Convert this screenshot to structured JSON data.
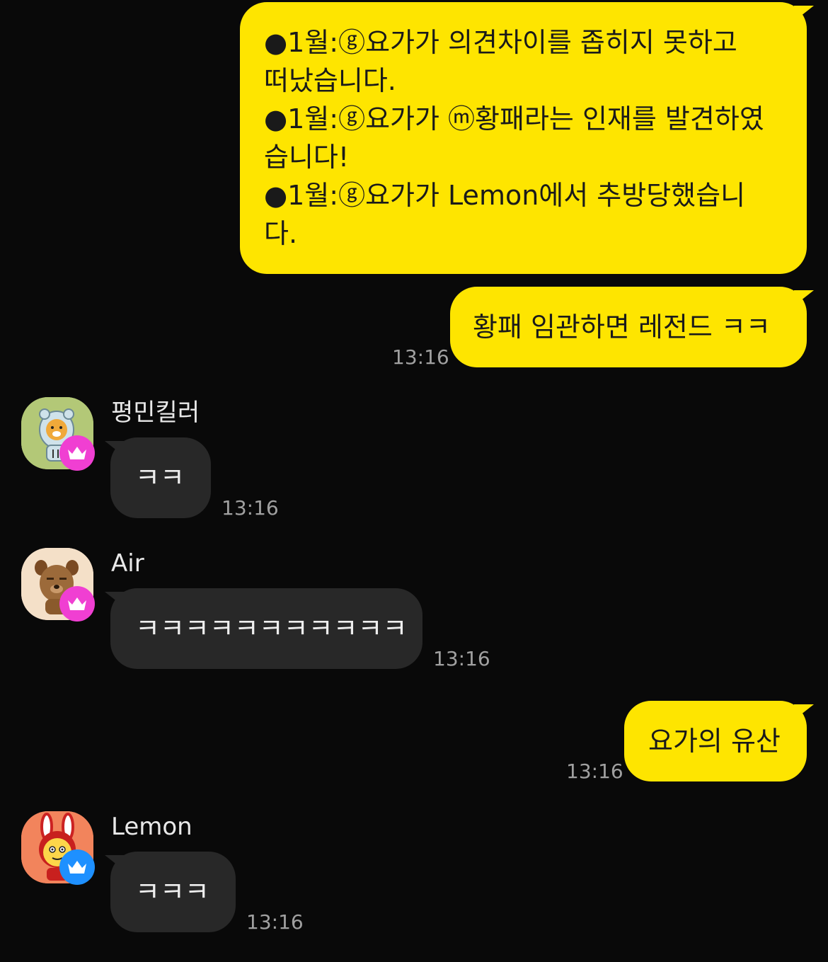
{
  "colors": {
    "background": "#090909",
    "outgoing_bubble": "#fee500",
    "incoming_bubble": "#282828",
    "owner_badge": "#f03fd2",
    "admin_badge": "#1e90ff"
  },
  "messages": [
    {
      "direction": "outgoing",
      "text": "●1월:ⓖ요가가 의견차이를 좁히지 못하고\n떠났습니다.\n●1월:ⓖ요가가 ⓜ황패라는 인재를 발견하였\n습니다!\n●1월:ⓖ요가가 Lemon에서 추방당했습니\n다.",
      "time": ""
    },
    {
      "direction": "outgoing",
      "text": "황패 임관하면 레전드 ㅋㅋ",
      "time": "13:16"
    },
    {
      "direction": "incoming",
      "sender": "평민킬러",
      "avatar": "ryan-hoodie-icon",
      "badge": "crown-pink-icon",
      "text": "ㅋㅋ",
      "time": "13:16"
    },
    {
      "direction": "incoming",
      "sender": "Air",
      "avatar": "frodo-dog-icon",
      "badge": "crown-pink-icon",
      "text": "ㅋㅋㅋㅋㅋㅋㅋㅋㅋㅋㅋ",
      "time": "13:16"
    },
    {
      "direction": "outgoing",
      "text": "요가의 유산",
      "time": "13:16"
    },
    {
      "direction": "incoming",
      "sender": "Lemon",
      "avatar": "muzi-rabbit-icon",
      "badge": "crown-blue-icon",
      "text": "ㅋㅋㅋ",
      "time": "13:16"
    }
  ]
}
